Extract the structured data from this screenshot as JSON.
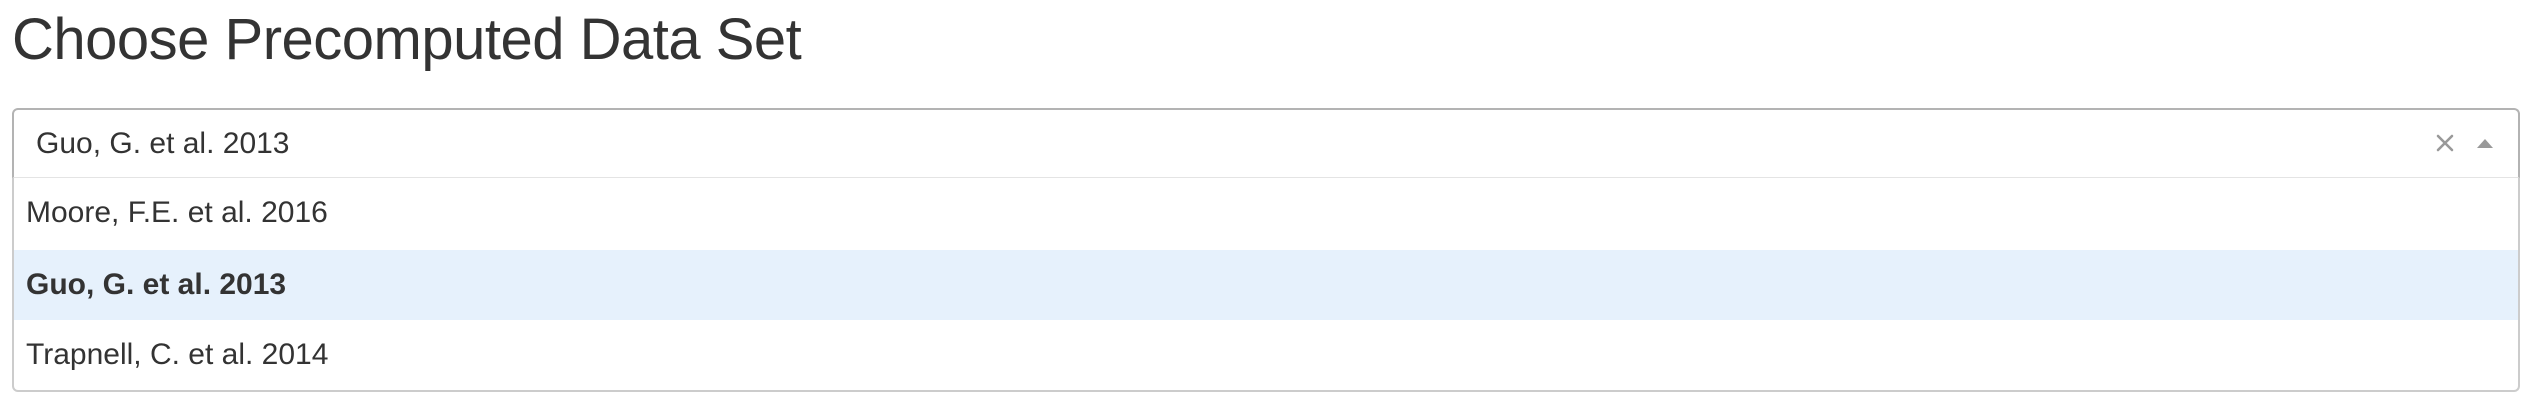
{
  "page": {
    "title": "Choose Precomputed Data Set"
  },
  "select": {
    "selected_value": "Guo, G. et al. 2013",
    "clear_icon": "clear-x-icon",
    "toggle_icon": "caret-up-icon",
    "options": [
      {
        "label": "Moore, F.E. et al. 2016",
        "selected": false
      },
      {
        "label": "Guo, G. et al. 2013",
        "selected": true
      },
      {
        "label": "Trapnell, C. et al. 2014",
        "selected": false
      }
    ]
  },
  "colors": {
    "text": "#333333",
    "highlight_background": "#e6f1fc",
    "border": "#b3b3b3",
    "icon": "#999999"
  }
}
